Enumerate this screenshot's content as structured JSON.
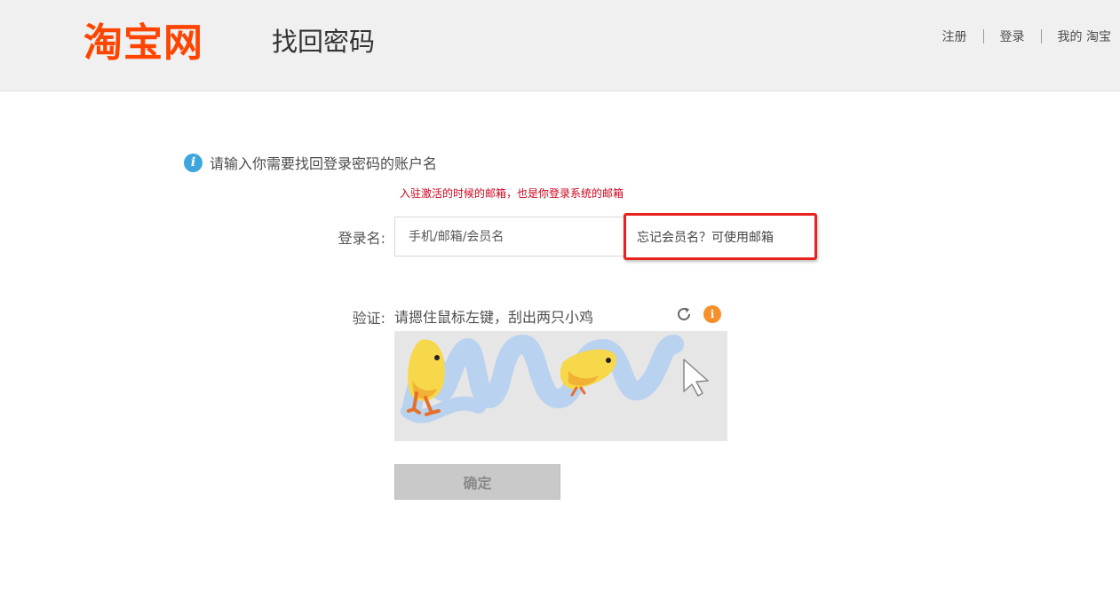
{
  "header": {
    "logo_text": "淘宝网",
    "page_title": "找回密码",
    "nav": {
      "register": "注册",
      "login": "登录",
      "my_taobao": "我的 淘宝"
    }
  },
  "form": {
    "tip": "请输入你需要找回登录密码的账户名",
    "red_note": "入驻激活的时候的邮箱，也是你登录系统的邮箱",
    "login_label": "登录名:",
    "login_placeholder": "手机/邮箱/会员名",
    "login_value": "",
    "hint": "忘记会员名？可使用邮箱",
    "verify_label": "验证:",
    "captcha_instruction": "请摁住鼠标左键，刮出两只小鸡",
    "confirm_label": "确定"
  },
  "colors": {
    "brand": "#ff4400",
    "info_blue": "#3ea6dd",
    "warning_orange": "#f5902a",
    "alert_red": "#e8231e"
  },
  "icons": {
    "tip": "info-icon",
    "refresh": "refresh-icon",
    "captcha_info": "info-icon",
    "cursor": "pointer-cursor-icon"
  }
}
